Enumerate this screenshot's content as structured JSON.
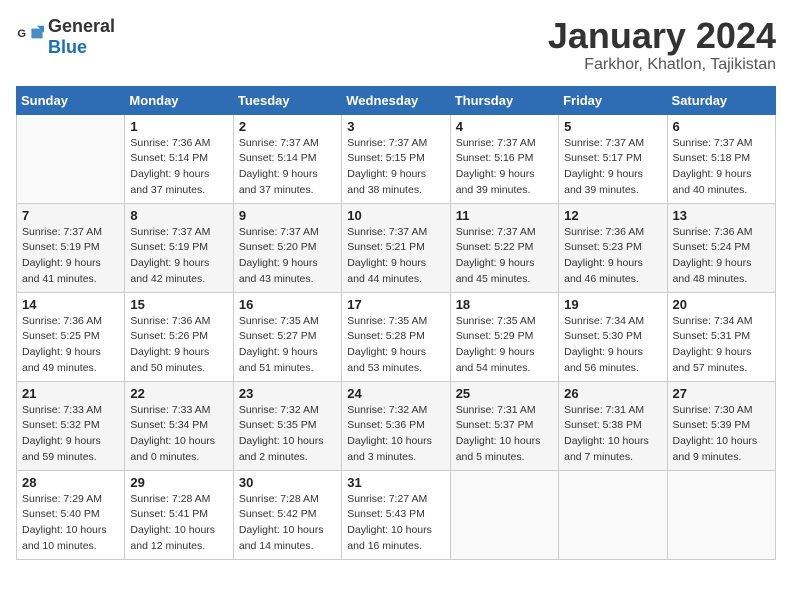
{
  "header": {
    "logo_general": "General",
    "logo_blue": "Blue",
    "title": "January 2024",
    "subtitle": "Farkhor, Khatlon, Tajikistan"
  },
  "days_of_week": [
    "Sunday",
    "Monday",
    "Tuesday",
    "Wednesday",
    "Thursday",
    "Friday",
    "Saturday"
  ],
  "weeks": [
    [
      {
        "day": "",
        "info": ""
      },
      {
        "day": "1",
        "info": "Sunrise: 7:36 AM\nSunset: 5:14 PM\nDaylight: 9 hours\nand 37 minutes."
      },
      {
        "day": "2",
        "info": "Sunrise: 7:37 AM\nSunset: 5:14 PM\nDaylight: 9 hours\nand 37 minutes."
      },
      {
        "day": "3",
        "info": "Sunrise: 7:37 AM\nSunset: 5:15 PM\nDaylight: 9 hours\nand 38 minutes."
      },
      {
        "day": "4",
        "info": "Sunrise: 7:37 AM\nSunset: 5:16 PM\nDaylight: 9 hours\nand 39 minutes."
      },
      {
        "day": "5",
        "info": "Sunrise: 7:37 AM\nSunset: 5:17 PM\nDaylight: 9 hours\nand 39 minutes."
      },
      {
        "day": "6",
        "info": "Sunrise: 7:37 AM\nSunset: 5:18 PM\nDaylight: 9 hours\nand 40 minutes."
      }
    ],
    [
      {
        "day": "7",
        "info": "Sunrise: 7:37 AM\nSunset: 5:19 PM\nDaylight: 9 hours\nand 41 minutes."
      },
      {
        "day": "8",
        "info": "Sunrise: 7:37 AM\nSunset: 5:19 PM\nDaylight: 9 hours\nand 42 minutes."
      },
      {
        "day": "9",
        "info": "Sunrise: 7:37 AM\nSunset: 5:20 PM\nDaylight: 9 hours\nand 43 minutes."
      },
      {
        "day": "10",
        "info": "Sunrise: 7:37 AM\nSunset: 5:21 PM\nDaylight: 9 hours\nand 44 minutes."
      },
      {
        "day": "11",
        "info": "Sunrise: 7:37 AM\nSunset: 5:22 PM\nDaylight: 9 hours\nand 45 minutes."
      },
      {
        "day": "12",
        "info": "Sunrise: 7:36 AM\nSunset: 5:23 PM\nDaylight: 9 hours\nand 46 minutes."
      },
      {
        "day": "13",
        "info": "Sunrise: 7:36 AM\nSunset: 5:24 PM\nDaylight: 9 hours\nand 48 minutes."
      }
    ],
    [
      {
        "day": "14",
        "info": "Sunrise: 7:36 AM\nSunset: 5:25 PM\nDaylight: 9 hours\nand 49 minutes."
      },
      {
        "day": "15",
        "info": "Sunrise: 7:36 AM\nSunset: 5:26 PM\nDaylight: 9 hours\nand 50 minutes."
      },
      {
        "day": "16",
        "info": "Sunrise: 7:35 AM\nSunset: 5:27 PM\nDaylight: 9 hours\nand 51 minutes."
      },
      {
        "day": "17",
        "info": "Sunrise: 7:35 AM\nSunset: 5:28 PM\nDaylight: 9 hours\nand 53 minutes."
      },
      {
        "day": "18",
        "info": "Sunrise: 7:35 AM\nSunset: 5:29 PM\nDaylight: 9 hours\nand 54 minutes."
      },
      {
        "day": "19",
        "info": "Sunrise: 7:34 AM\nSunset: 5:30 PM\nDaylight: 9 hours\nand 56 minutes."
      },
      {
        "day": "20",
        "info": "Sunrise: 7:34 AM\nSunset: 5:31 PM\nDaylight: 9 hours\nand 57 minutes."
      }
    ],
    [
      {
        "day": "21",
        "info": "Sunrise: 7:33 AM\nSunset: 5:32 PM\nDaylight: 9 hours\nand 59 minutes."
      },
      {
        "day": "22",
        "info": "Sunrise: 7:33 AM\nSunset: 5:34 PM\nDaylight: 10 hours\nand 0 minutes."
      },
      {
        "day": "23",
        "info": "Sunrise: 7:32 AM\nSunset: 5:35 PM\nDaylight: 10 hours\nand 2 minutes."
      },
      {
        "day": "24",
        "info": "Sunrise: 7:32 AM\nSunset: 5:36 PM\nDaylight: 10 hours\nand 3 minutes."
      },
      {
        "day": "25",
        "info": "Sunrise: 7:31 AM\nSunset: 5:37 PM\nDaylight: 10 hours\nand 5 minutes."
      },
      {
        "day": "26",
        "info": "Sunrise: 7:31 AM\nSunset: 5:38 PM\nDaylight: 10 hours\nand 7 minutes."
      },
      {
        "day": "27",
        "info": "Sunrise: 7:30 AM\nSunset: 5:39 PM\nDaylight: 10 hours\nand 9 minutes."
      }
    ],
    [
      {
        "day": "28",
        "info": "Sunrise: 7:29 AM\nSunset: 5:40 PM\nDaylight: 10 hours\nand 10 minutes."
      },
      {
        "day": "29",
        "info": "Sunrise: 7:28 AM\nSunset: 5:41 PM\nDaylight: 10 hours\nand 12 minutes."
      },
      {
        "day": "30",
        "info": "Sunrise: 7:28 AM\nSunset: 5:42 PM\nDaylight: 10 hours\nand 14 minutes."
      },
      {
        "day": "31",
        "info": "Sunrise: 7:27 AM\nSunset: 5:43 PM\nDaylight: 10 hours\nand 16 minutes."
      },
      {
        "day": "",
        "info": ""
      },
      {
        "day": "",
        "info": ""
      },
      {
        "day": "",
        "info": ""
      }
    ]
  ]
}
